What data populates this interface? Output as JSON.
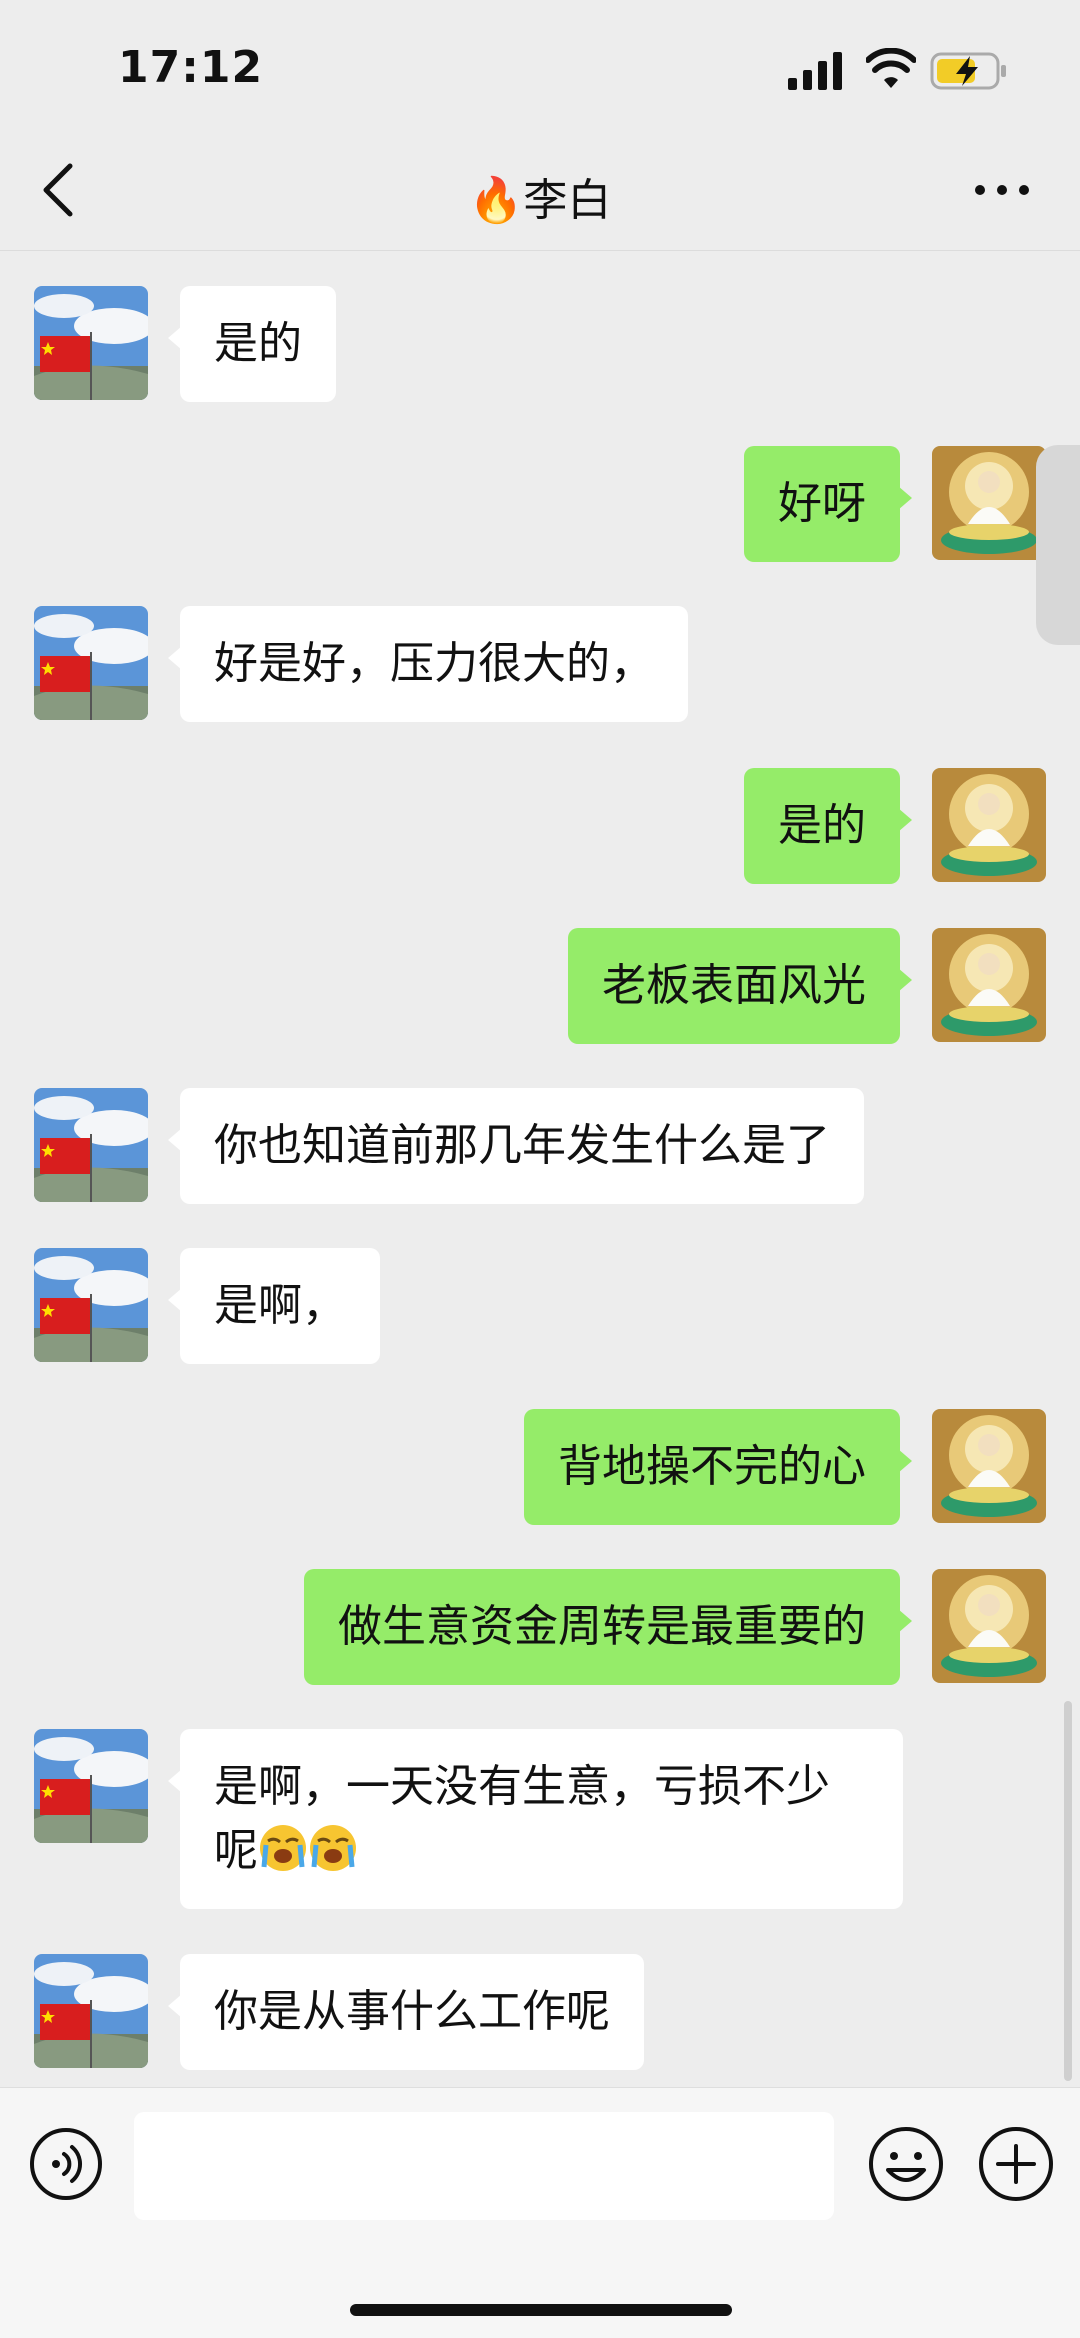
{
  "status": {
    "time": "17:12"
  },
  "header": {
    "title_emoji": "🔥",
    "title": "李白"
  },
  "messages": [
    {
      "from": "them",
      "text": "是的"
    },
    {
      "from": "me",
      "text": "好呀"
    },
    {
      "from": "them",
      "text": "好是好，压力很大的，"
    },
    {
      "from": "me",
      "text": "是的"
    },
    {
      "from": "me",
      "text": "老板表面风光"
    },
    {
      "from": "them",
      "text": "你也知道前那几年发生什么是了"
    },
    {
      "from": "them",
      "text": "是啊，"
    },
    {
      "from": "me",
      "text": "背地操不完的心"
    },
    {
      "from": "me",
      "text": "做生意资金周转是最重要的"
    },
    {
      "from": "them",
      "text": "是啊，一天没有生意，亏损不少呢",
      "emojis": [
        "loudly-crying-face",
        "loudly-crying-face"
      ]
    },
    {
      "from": "them",
      "text": "你是从事什么工作呢"
    }
  ],
  "icons": {
    "back": "chevron-left-icon",
    "more": "more-icon",
    "voice": "voice-icon",
    "emoji": "emoji-icon",
    "plus": "plus-icon"
  },
  "colors": {
    "outgoing_bubble": "#95ec69",
    "incoming_bubble": "#ffffff",
    "background": "#ededed"
  }
}
